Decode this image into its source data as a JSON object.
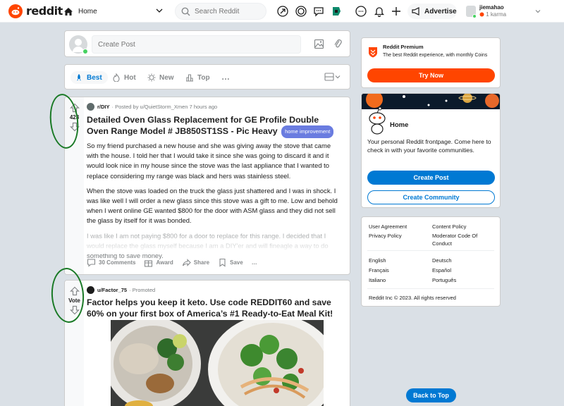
{
  "header": {
    "logo_text": "reddit",
    "feed_label": "Home",
    "search_placeholder": "Search Reddit",
    "advertise_label": "Advertise",
    "username": "jiemahao",
    "karma": "1 karma"
  },
  "create_post": {
    "placeholder": "Create Post"
  },
  "sort": {
    "items": [
      "Best",
      "Hot",
      "New",
      "Top"
    ],
    "more": "…"
  },
  "post1": {
    "votes": "423",
    "subreddit": "r/DIY",
    "meta": "· Posted by u/QuietStorm_Xmen 7 hours ago",
    "title": "Detailed Oven Glass Replacement for GE Profile Double Oven Range Model # JB850ST1SS - Pic Heavy",
    "flair": "home improvement",
    "paragraphs": [
      "So my friend purchased a new house and she was giving away the stove that came with the house. I told her that I would take it since she was going to discard it and it would look nice in my house since the stove was the last appliance that I wanted to replace considering my range was black and hers was stainless steel.",
      "When the stove was loaded on the truck the glass just shattered and I was in shock. I was like well I will order a new glass since this stove was a gift to me. Low and behold when I went online GE wanted $800 for the door with ASM glass and they did not sell the glass by itself for it was bonded.",
      "I was like I am not paying $800 for a door to replace for this range. I decided that I would replace the glass myself because I am a DIY'er and will fineagle a way to do something to save money."
    ],
    "comments": "30 Comments",
    "award": "Award",
    "share": "Share",
    "save": "Save",
    "more": "…"
  },
  "post2": {
    "vote_label": "Vote",
    "author": "u/Factor_75",
    "promoted": "· Promoted",
    "title": "Factor helps you keep it keto. Use code REDDIT60 and save 60% on your first box of America’s #1 Ready-to-Eat Meal Kit!"
  },
  "premium": {
    "title": "Reddit Premium",
    "description": "The best Reddit experience, with monthly Coins",
    "button": "Try Now"
  },
  "home_card": {
    "title": "Home",
    "description": "Your personal Reddit frontpage. Come here to check in with your favorite communities.",
    "create_post": "Create Post",
    "create_community": "Create Community"
  },
  "footer_links": {
    "col1": [
      "User Agreement",
      "Privacy Policy"
    ],
    "col2": [
      "Content Policy",
      "Moderator Code Of Conduct"
    ],
    "lang1": [
      "English",
      "Français",
      "Italiano"
    ],
    "lang2": [
      "Deutsch",
      "Español",
      "Português"
    ],
    "copyright": "Reddit Inc © 2023. All rights reserved"
  },
  "back_to_top": "Back to Top",
  "colors": {
    "brand": "#ff4500",
    "accent": "#0079d3",
    "annotation": "#1a7a26"
  }
}
